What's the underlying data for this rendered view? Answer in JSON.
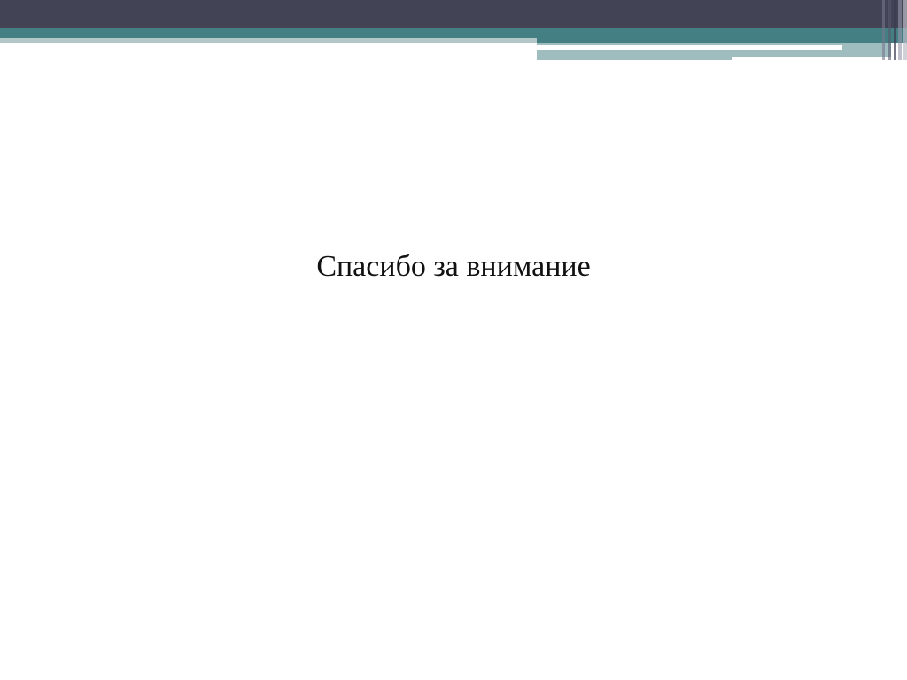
{
  "slide": {
    "text": "Спасибо за внимание"
  },
  "colors": {
    "header_dark": "#434356",
    "accent_teal": "#447f83",
    "light_teal": "#9fbcbf"
  }
}
